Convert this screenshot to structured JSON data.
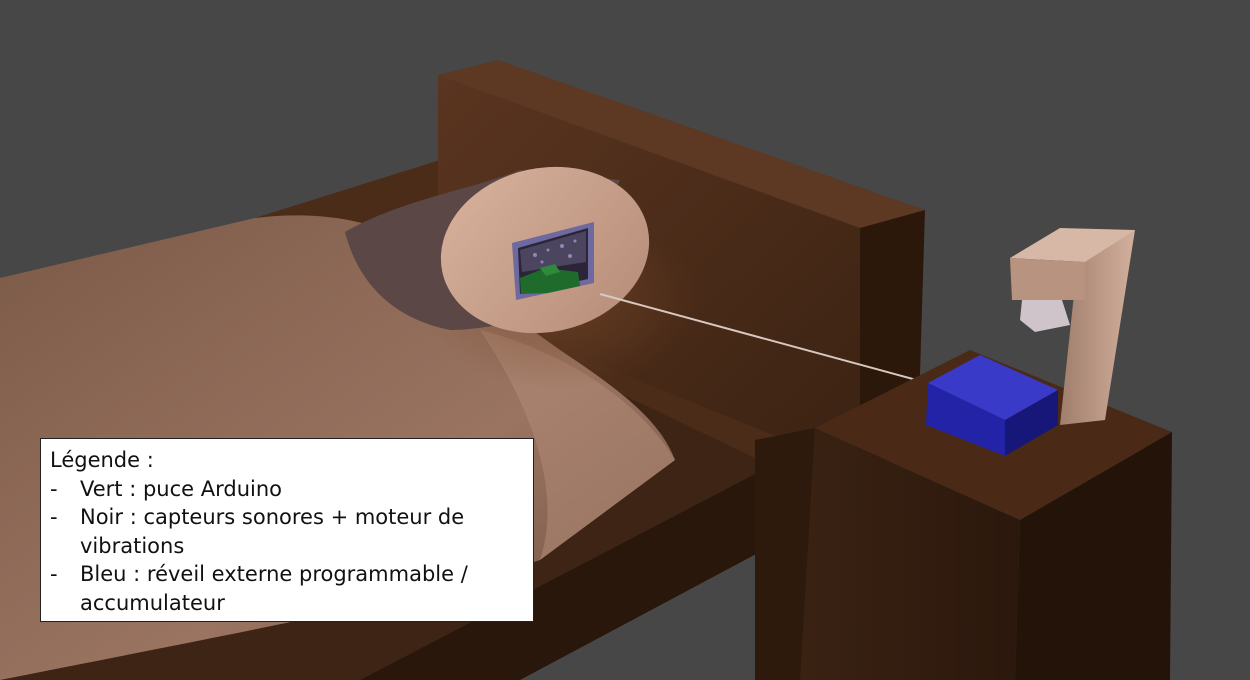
{
  "legend": {
    "title": "Légende :",
    "items": [
      {
        "bullet": "-",
        "text": "Vert : puce Arduino"
      },
      {
        "bullet": "-",
        "text": "Noir : capteurs sonores + moteur de vibrations"
      },
      {
        "bullet": "-",
        "text": "Bleu : réveil externe programmable / accumulateur"
      }
    ]
  },
  "colors": {
    "background": "#474747",
    "wood": "#4a2a17",
    "sheet": "#8f6a55",
    "pillow_case": "#5a4746",
    "pillow_face": "#d2aa95",
    "arduino_green": "#1e6b2c",
    "alarm_blue": "#2323a8",
    "lamp": "#c8a38f"
  },
  "objects": [
    "bed-frame",
    "headboard",
    "mattress-sheet",
    "pillow",
    "arduino-chip",
    "sound-sensors",
    "cable",
    "nightstand",
    "alarm-box",
    "lamp"
  ]
}
